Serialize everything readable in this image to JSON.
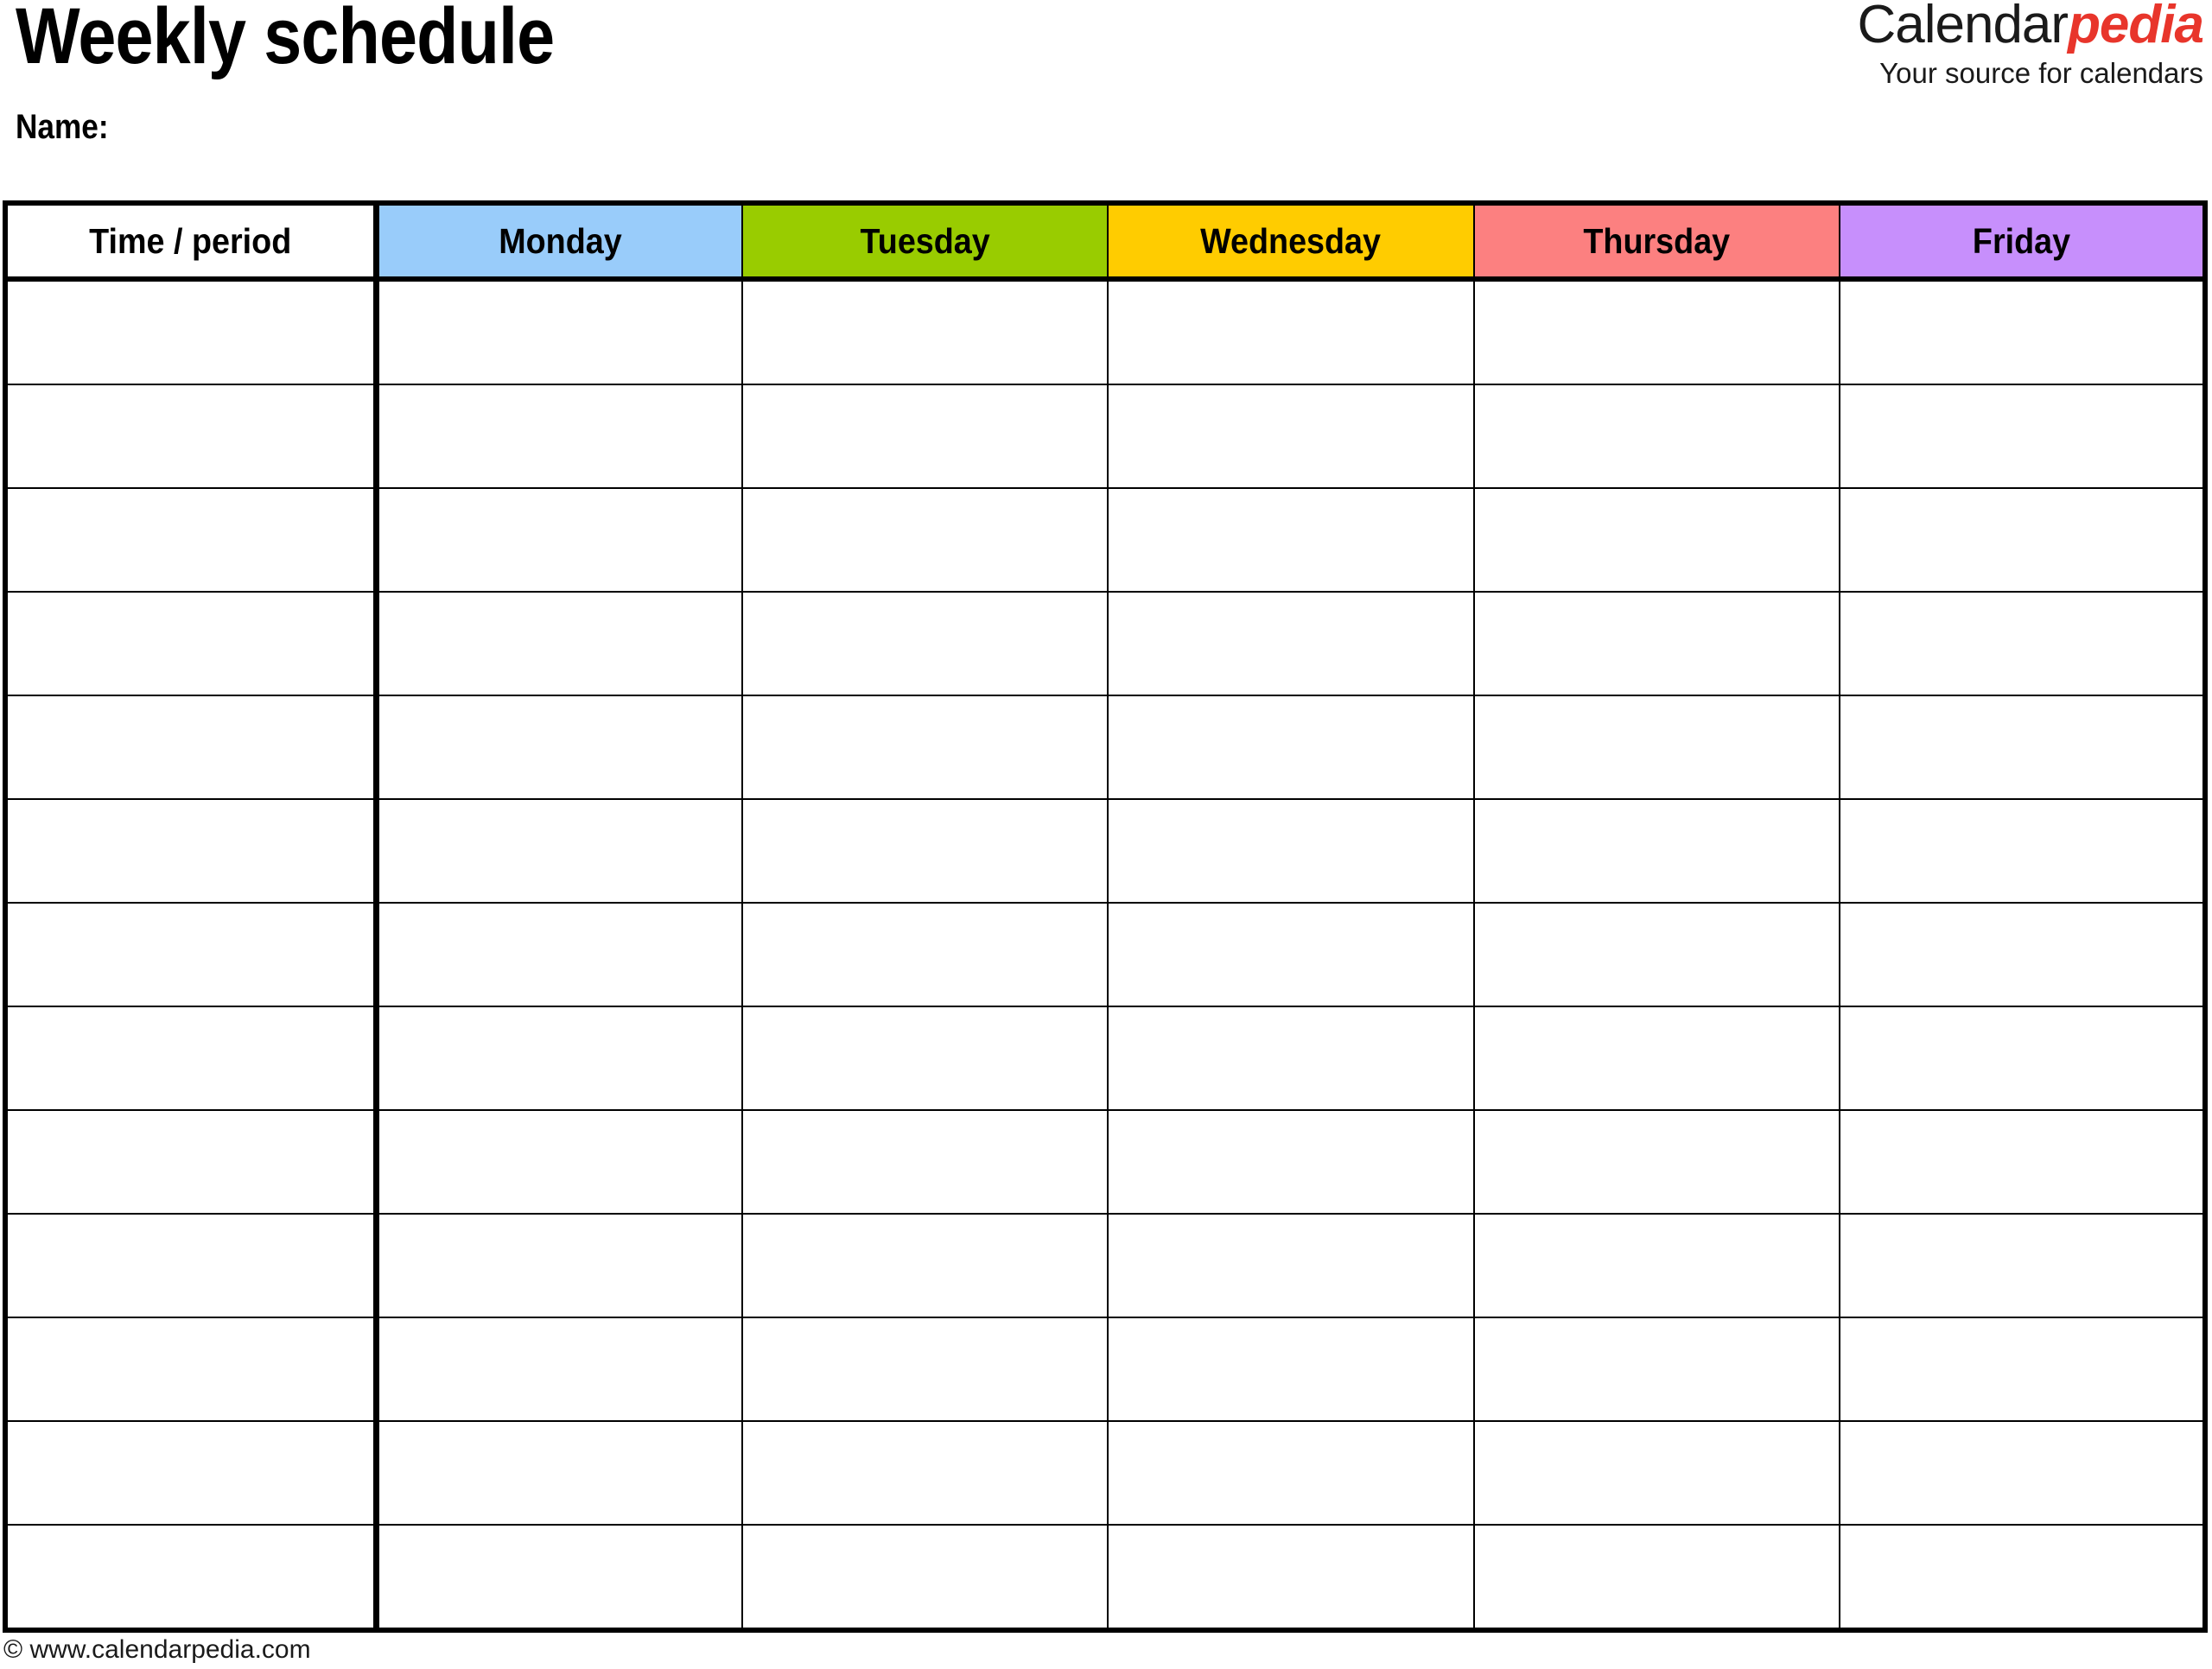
{
  "document": {
    "title": "Weekly schedule",
    "name_label": "Name:"
  },
  "logo": {
    "word_primary": "Calendar",
    "word_accent": "pedia",
    "tagline": "Your source for calendars",
    "accent_color": "#e8352b",
    "primary_color": "#1a1a1a"
  },
  "table": {
    "columns": [
      {
        "label": "Time / period",
        "bg": "#ffffff",
        "key": "time"
      },
      {
        "label": "Monday",
        "bg": "#99ccfa",
        "key": "monday"
      },
      {
        "label": "Tuesday",
        "bg": "#99cc00",
        "key": "tuesday"
      },
      {
        "label": "Wednesday",
        "bg": "#ffcc00",
        "key": "wednesday"
      },
      {
        "label": "Thursday",
        "bg": "#fc8080",
        "key": "thursday"
      },
      {
        "label": "Friday",
        "bg": "#c78ffc",
        "key": "friday"
      }
    ],
    "row_count": 13,
    "rows": [
      {
        "time": "",
        "monday": "",
        "tuesday": "",
        "wednesday": "",
        "thursday": "",
        "friday": ""
      },
      {
        "time": "",
        "monday": "",
        "tuesday": "",
        "wednesday": "",
        "thursday": "",
        "friday": ""
      },
      {
        "time": "",
        "monday": "",
        "tuesday": "",
        "wednesday": "",
        "thursday": "",
        "friday": ""
      },
      {
        "time": "",
        "monday": "",
        "tuesday": "",
        "wednesday": "",
        "thursday": "",
        "friday": ""
      },
      {
        "time": "",
        "monday": "",
        "tuesday": "",
        "wednesday": "",
        "thursday": "",
        "friday": ""
      },
      {
        "time": "",
        "monday": "",
        "tuesday": "",
        "wednesday": "",
        "thursday": "",
        "friday": ""
      },
      {
        "time": "",
        "monday": "",
        "tuesday": "",
        "wednesday": "",
        "thursday": "",
        "friday": ""
      },
      {
        "time": "",
        "monday": "",
        "tuesday": "",
        "wednesday": "",
        "thursday": "",
        "friday": ""
      },
      {
        "time": "",
        "monday": "",
        "tuesday": "",
        "wednesday": "",
        "thursday": "",
        "friday": ""
      },
      {
        "time": "",
        "monday": "",
        "tuesday": "",
        "wednesday": "",
        "thursday": "",
        "friday": ""
      },
      {
        "time": "",
        "monday": "",
        "tuesday": "",
        "wednesday": "",
        "thursday": "",
        "friday": ""
      },
      {
        "time": "",
        "monday": "",
        "tuesday": "",
        "wednesday": "",
        "thursday": "",
        "friday": ""
      },
      {
        "time": "",
        "monday": "",
        "tuesday": "",
        "wednesday": "",
        "thursday": "",
        "friday": ""
      }
    ]
  },
  "footer": {
    "copyright": "© www.calendarpedia.com"
  }
}
